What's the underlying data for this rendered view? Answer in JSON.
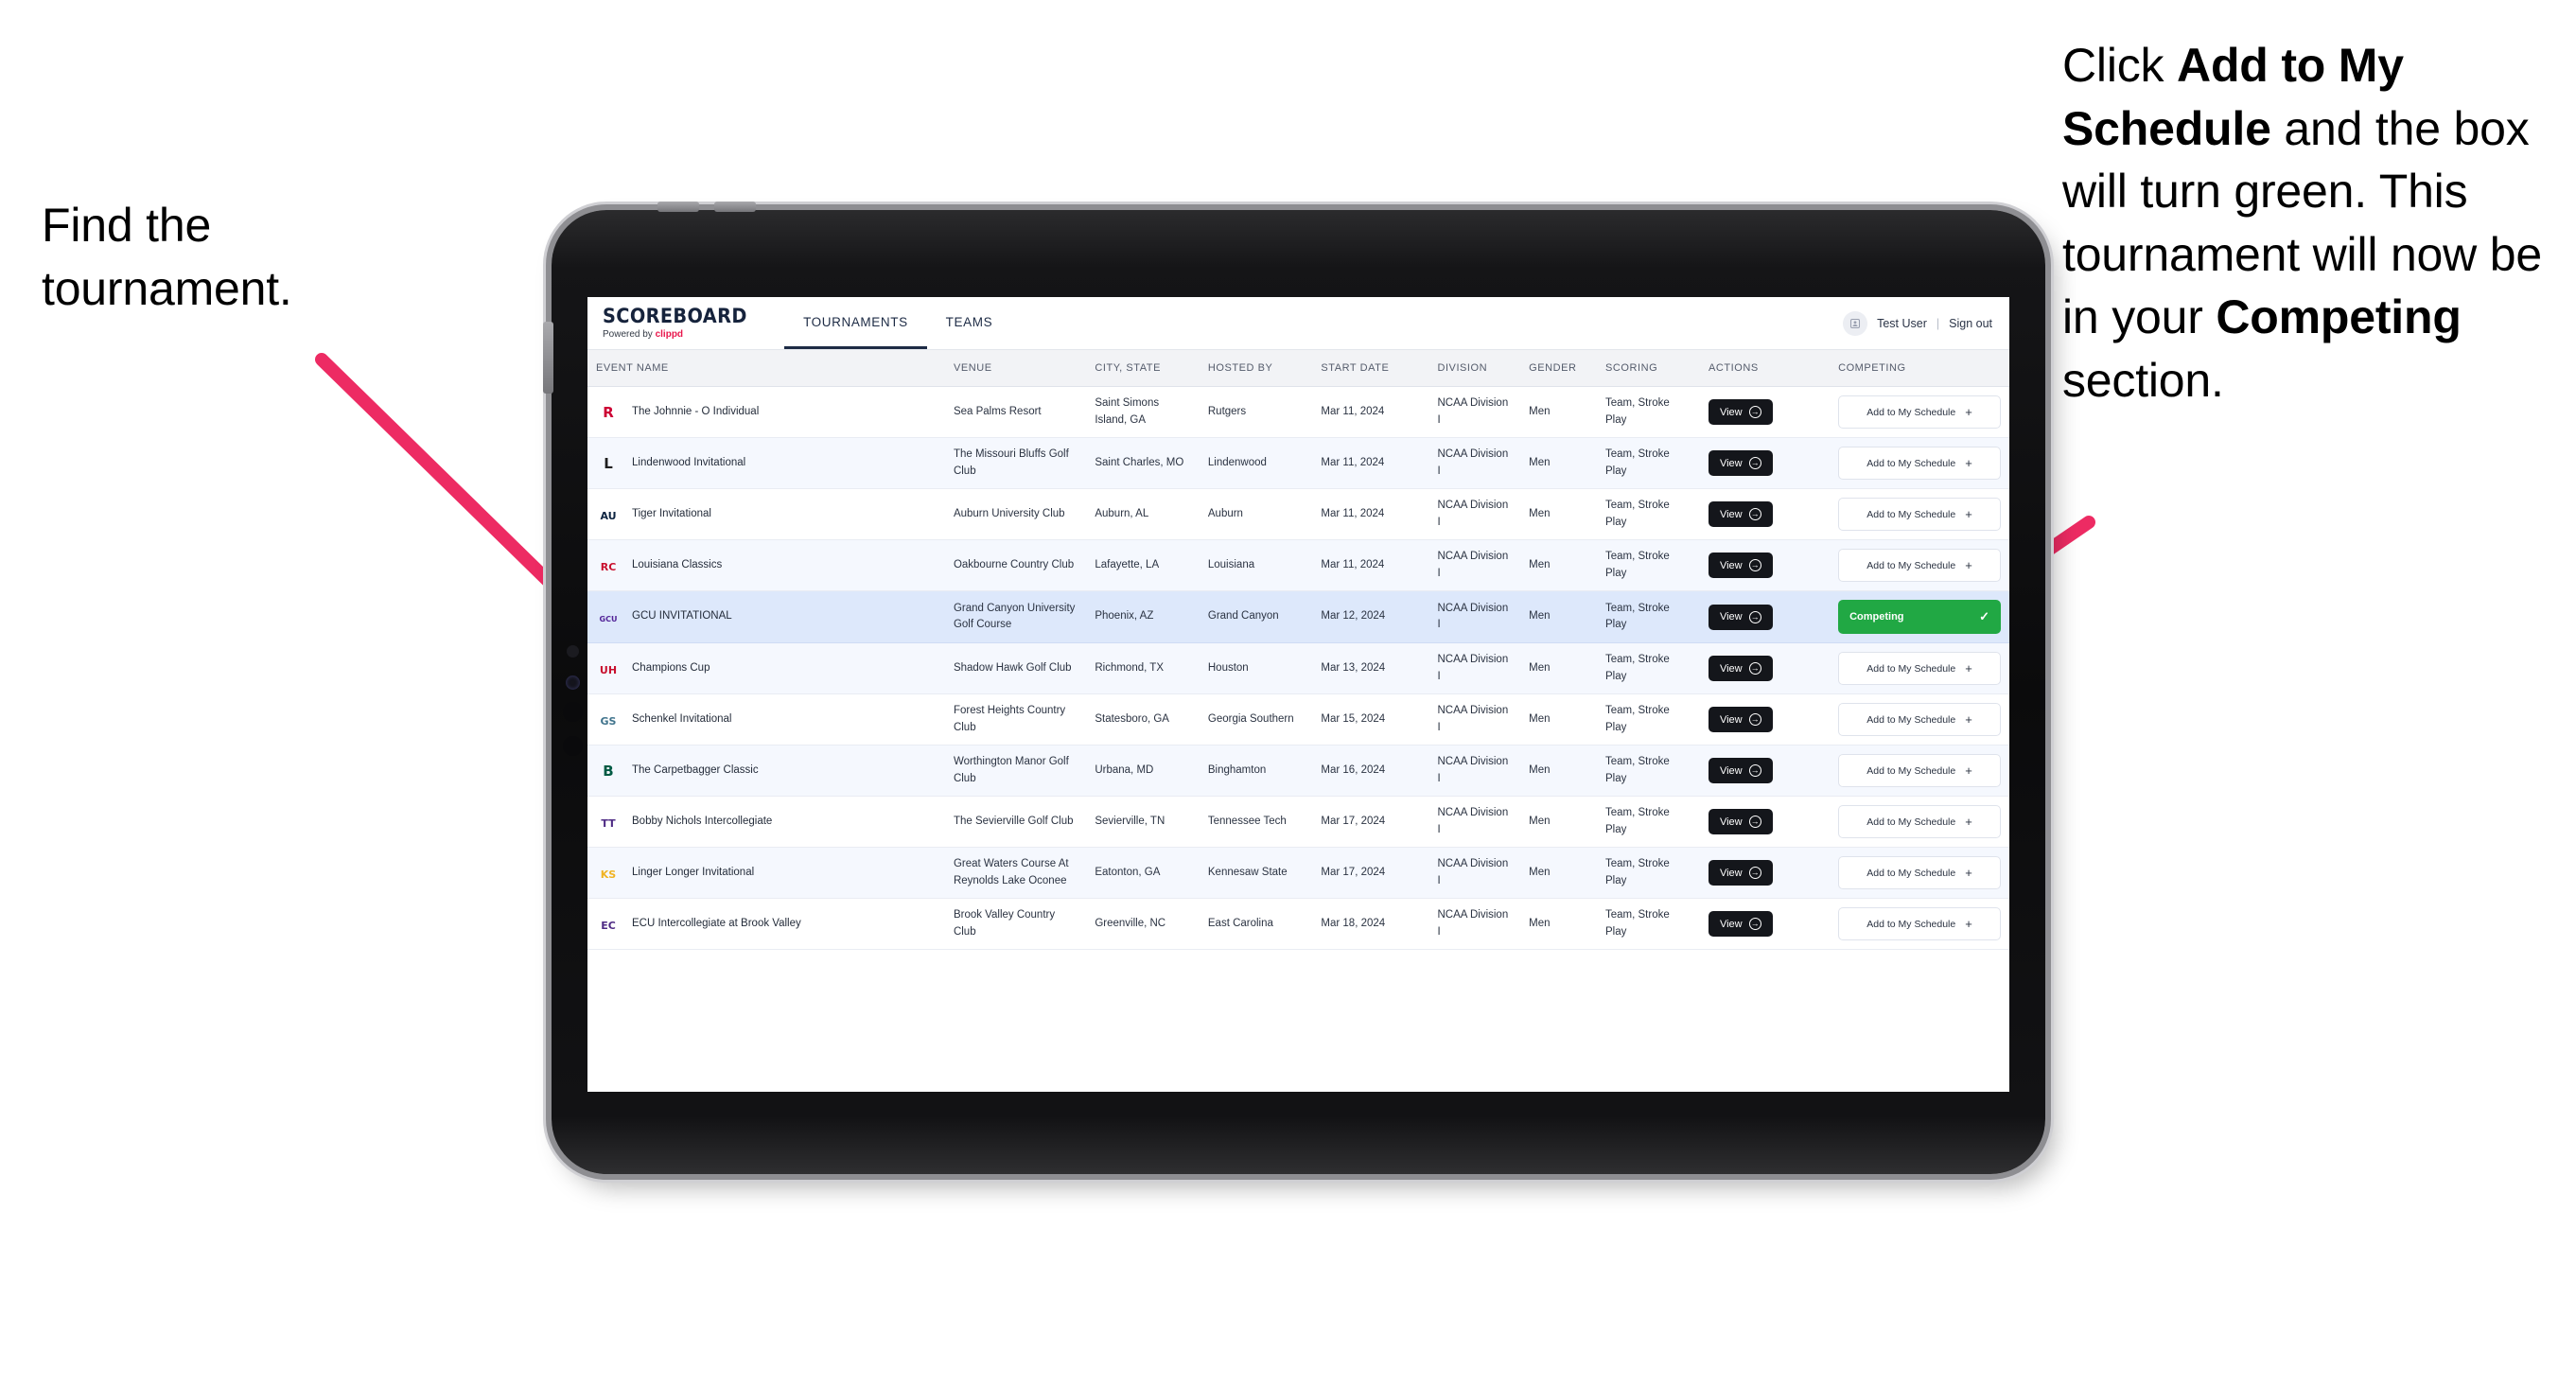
{
  "annotations": {
    "left": {
      "line1": "Find the",
      "line2": "tournament."
    },
    "right": {
      "part1": "Click ",
      "bold1": "Add to My Schedule",
      "part2": " and the box will turn green. This tournament will now be in your ",
      "bold2": "Competing",
      "part3": " section."
    },
    "arrow_color": "#ed2b63"
  },
  "app": {
    "brand": {
      "title": "SCOREBOARD",
      "powered_prefix": "Powered by ",
      "powered_name": "clippd"
    },
    "nav": [
      {
        "label": "TOURNAMENTS",
        "active": true
      },
      {
        "label": "TEAMS",
        "active": false
      }
    ],
    "user": {
      "avatar_icon": "user-avatar-icon",
      "name": "Test User",
      "separator": "|",
      "signout": "Sign out"
    },
    "table": {
      "columns": [
        "EVENT NAME",
        "VENUE",
        "CITY, STATE",
        "HOSTED BY",
        "START DATE",
        "DIVISION",
        "GENDER",
        "SCORING",
        "ACTIONS",
        "COMPETING"
      ],
      "view_label": "View",
      "add_label": "Add to My Schedule",
      "add_plus": "+",
      "competing_label": "Competing",
      "competing_check": "✓",
      "rows": [
        {
          "logo": "rutgers-logo",
          "logo_text": "R",
          "logo_color": "#cc0033",
          "event": "The Johnnie - O Individual",
          "venue": "Sea Palms Resort",
          "city": "Saint Simons Island, GA",
          "host": "Rutgers",
          "date": "Mar 11, 2024",
          "division": "NCAA Division I",
          "gender": "Men",
          "scoring": "Team, Stroke Play",
          "competing": false
        },
        {
          "logo": "lindenwood-lions-logo",
          "logo_text": "L",
          "logo_color": "#1f1f1f",
          "event": "Lindenwood Invitational",
          "venue": "The Missouri Bluffs Golf Club",
          "city": "Saint Charles, MO",
          "host": "Lindenwood",
          "date": "Mar 11, 2024",
          "division": "NCAA Division I",
          "gender": "Men",
          "scoring": "Team, Stroke Play",
          "competing": false
        },
        {
          "logo": "auburn-tigers-logo",
          "logo_text": "AU",
          "logo_color": "#0c2340",
          "event": "Tiger Invitational",
          "venue": "Auburn University Club",
          "city": "Auburn, AL",
          "host": "Auburn",
          "date": "Mar 11, 2024",
          "division": "NCAA Division I",
          "gender": "Men",
          "scoring": "Team, Stroke Play",
          "competing": false
        },
        {
          "logo": "louisiana-ragin-cajuns-logo",
          "logo_text": "RC",
          "logo_color": "#c8102e",
          "event": "Louisiana Classics",
          "venue": "Oakbourne Country Club",
          "city": "Lafayette, LA",
          "host": "Louisiana",
          "date": "Mar 11, 2024",
          "division": "NCAA Division I",
          "gender": "Men",
          "scoring": "Team, Stroke Play",
          "competing": false
        },
        {
          "logo": "grand-canyon-lopes-logo",
          "logo_text": "GCU",
          "logo_color": "#522398",
          "event": "GCU INVITATIONAL",
          "venue": "Grand Canyon University Golf Course",
          "city": "Phoenix, AZ",
          "host": "Grand Canyon",
          "date": "Mar 12, 2024",
          "division": "NCAA Division I",
          "gender": "Men",
          "scoring": "Team, Stroke Play",
          "competing": true
        },
        {
          "logo": "houston-cougars-logo",
          "logo_text": "UH",
          "logo_color": "#c8102e",
          "event": "Champions Cup",
          "venue": "Shadow Hawk Golf Club",
          "city": "Richmond, TX",
          "host": "Houston",
          "date": "Mar 13, 2024",
          "division": "NCAA Division I",
          "gender": "Men",
          "scoring": "Team, Stroke Play",
          "competing": false
        },
        {
          "logo": "georgia-southern-eagles-logo",
          "logo_text": "GS",
          "logo_color": "#41748d",
          "event": "Schenkel Invitational",
          "venue": "Forest Heights Country Club",
          "city": "Statesboro, GA",
          "host": "Georgia Southern",
          "date": "Mar 15, 2024",
          "division": "NCAA Division I",
          "gender": "Men",
          "scoring": "Team, Stroke Play",
          "competing": false
        },
        {
          "logo": "binghamton-bearcats-logo",
          "logo_text": "B",
          "logo_color": "#005a43",
          "event": "The Carpetbagger Classic",
          "venue": "Worthington Manor Golf Club",
          "city": "Urbana, MD",
          "host": "Binghamton",
          "date": "Mar 16, 2024",
          "division": "NCAA Division I",
          "gender": "Men",
          "scoring": "Team, Stroke Play",
          "competing": false
        },
        {
          "logo": "tennessee-tech-golden-eagles-logo",
          "logo_text": "TT",
          "logo_color": "#4e2a84",
          "event": "Bobby Nichols Intercollegiate",
          "venue": "The Sevierville Golf Club",
          "city": "Sevierville, TN",
          "host": "Tennessee Tech",
          "date": "Mar 17, 2024",
          "division": "NCAA Division I",
          "gender": "Men",
          "scoring": "Team, Stroke Play",
          "competing": false
        },
        {
          "logo": "kennesaw-state-owls-logo",
          "logo_text": "KS",
          "logo_color": "#f0b323",
          "event": "Linger Longer Invitational",
          "venue": "Great Waters Course At Reynolds Lake Oconee",
          "city": "Eatonton, GA",
          "host": "Kennesaw State",
          "date": "Mar 17, 2024",
          "division": "NCAA Division I",
          "gender": "Men",
          "scoring": "Team, Stroke Play",
          "competing": false
        },
        {
          "logo": "east-carolina-pirates-logo",
          "logo_text": "EC",
          "logo_color": "#4e2a84",
          "event": "ECU Intercollegiate at Brook Valley",
          "venue": "Brook Valley Country Club",
          "city": "Greenville, NC",
          "host": "East Carolina",
          "date": "Mar 18, 2024",
          "division": "NCAA Division I",
          "gender": "Men",
          "scoring": "Team, Stroke Play",
          "competing": false
        }
      ]
    }
  }
}
